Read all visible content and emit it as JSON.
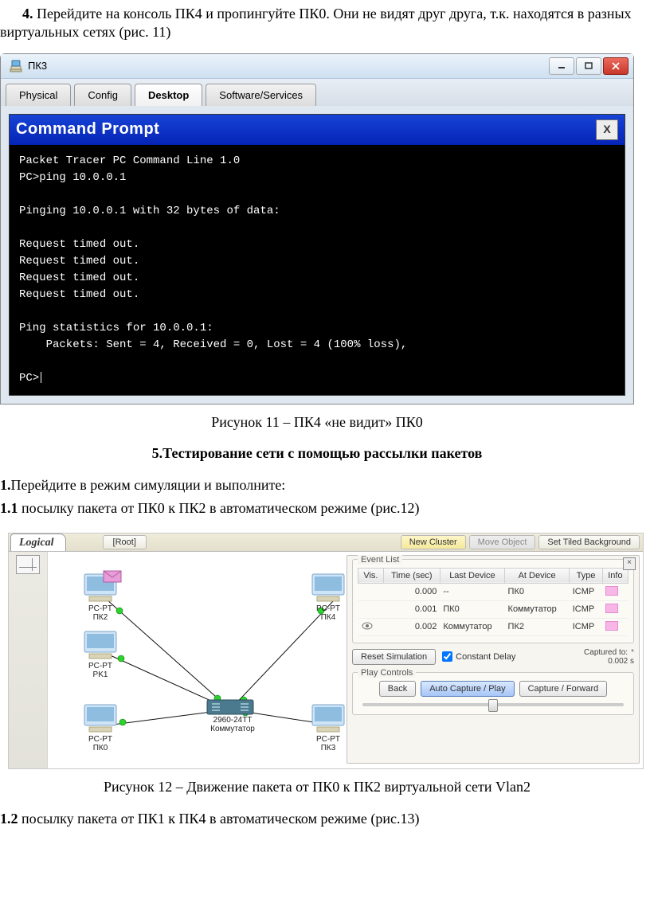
{
  "step4": {
    "num": "4.",
    "text": " Перейдите на консоль ПК4 и пропингуйте ПК0. Они не видят друг друга, т.к. находятся в разных виртуальных сетях (рис. 11)"
  },
  "fig11": {
    "window_title": "ПК3",
    "tabs": [
      "Physical",
      "Config",
      "Desktop",
      "Software/Services"
    ],
    "active_tab_index": 2,
    "cmd_title": "Command Prompt",
    "cmd_close": "X",
    "cmd_lines": [
      "Packet Tracer PC Command Line 1.0",
      "PC>ping 10.0.0.1",
      "",
      "Pinging 10.0.0.1 with 32 bytes of data:",
      "",
      "Request timed out.",
      "Request timed out.",
      "Request timed out.",
      "Request timed out.",
      "",
      "Ping statistics for 10.0.0.1:",
      "    Packets: Sent = 4, Received = 0, Lost = 4 (100% loss),",
      "",
      "PC>"
    ],
    "caption": "Рисунок 11 – ПК4 «не видит» ПК0"
  },
  "heading5": "5.Тестирование сети с помощью рассылки пакетов",
  "step1": {
    "prefix": "1.",
    "text": "Перейдите в режим симуляции и выполните:"
  },
  "step1_1": {
    "prefix": "1.1",
    "text": " посылку пакета от ПК0 к ПК2 в автоматическом режиме (рис.12)"
  },
  "fig12": {
    "logical_label": "Logical",
    "root_label": "[Root]",
    "top_buttons": {
      "new_cluster": "New Cluster",
      "move_object": "Move Object",
      "set_bg": "Set Tiled Background"
    },
    "devices": {
      "pk2": {
        "line1": "PC-PT",
        "line2": "ПК2"
      },
      "pk1": {
        "line1": "PC-PT",
        "line2": "PK1"
      },
      "pk0": {
        "line1": "PC-PT",
        "line2": "ПК0"
      },
      "pk4": {
        "line1": "PC-PT",
        "line2": "ПК4"
      },
      "pk3": {
        "line1": "PC-PT",
        "line2": "ПК3"
      },
      "switch": {
        "line1": "2960-24TT",
        "line2": "Коммутатор"
      }
    },
    "panel": {
      "close": "×",
      "event_list_label": "Event List",
      "cols": {
        "vis": "Vis.",
        "time": "Time (sec)",
        "last": "Last Device",
        "at": "At Device",
        "type": "Type",
        "info": "Info"
      },
      "rows": [
        {
          "vis": "",
          "time": "0.000",
          "last": "--",
          "at": "ПК0",
          "type": "ICMP"
        },
        {
          "vis": "",
          "time": "0.001",
          "last": "ПК0",
          "at": "Коммутатор",
          "type": "ICMP"
        },
        {
          "vis": "eye",
          "time": "0.002",
          "last": "Коммутатор",
          "at": "ПК2",
          "type": "ICMP"
        }
      ],
      "reset_btn": "Reset Simulation",
      "constant_delay": "Constant Delay",
      "captured_to_label": "Captured to:",
      "captured_to_value": "0.002 s",
      "play_controls_label": "Play Controls",
      "back_btn": "Back",
      "autoplay_btn": "Auto Capture / Play",
      "fwd_btn": "Capture / Forward"
    },
    "caption": "Рисунок 12 – Движение пакета от ПК0 к ПК2 виртуальной сети Vlan2"
  },
  "step1_2": {
    "prefix": "1.2",
    "text": " посылку пакета от ПК1 к ПК4 в автоматическом режиме (рис.13)"
  }
}
